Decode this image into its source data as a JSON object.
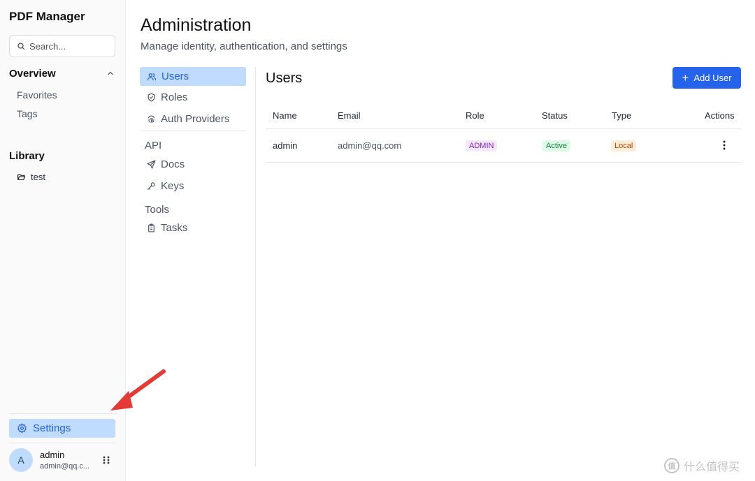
{
  "app": {
    "title": "PDF Manager"
  },
  "search": {
    "placeholder": "Search..."
  },
  "sidebar": {
    "overview": {
      "label": "Overview",
      "items": [
        {
          "label": "Favorites"
        },
        {
          "label": "Tags"
        }
      ]
    },
    "library": {
      "label": "Library",
      "items": [
        {
          "label": "test",
          "icon": "folder-open-icon"
        }
      ]
    },
    "settings_label": "Settings",
    "user": {
      "initial": "A",
      "name": "admin",
      "email": "admin@qq.c..."
    }
  },
  "page": {
    "title": "Administration",
    "subtitle": "Manage identity, authentication, and settings"
  },
  "subnav": {
    "primary": [
      {
        "label": "Users",
        "icon": "users-icon",
        "active": true
      },
      {
        "label": "Roles",
        "icon": "shield-icon"
      },
      {
        "label": "Auth Providers",
        "icon": "fingerprint-icon"
      }
    ],
    "api": {
      "label": "API",
      "items": [
        {
          "label": "Docs",
          "icon": "send-icon"
        },
        {
          "label": "Keys",
          "icon": "key-icon"
        }
      ]
    },
    "tools": {
      "label": "Tools",
      "items": [
        {
          "label": "Tasks",
          "icon": "clipboard-icon"
        }
      ]
    }
  },
  "users": {
    "title": "Users",
    "add_button": "Add User",
    "columns": {
      "name": "Name",
      "email": "Email",
      "role": "Role",
      "status": "Status",
      "type": "Type",
      "actions": "Actions"
    },
    "rows": [
      {
        "name": "admin",
        "email": "admin@qq.com",
        "role": "ADMIN",
        "status": "Active",
        "type": "Local"
      }
    ]
  },
  "watermark": {
    "mark": "值",
    "text": "什么值得买"
  },
  "colors": {
    "accent": "#2563eb",
    "active_bg": "#bfdbfe",
    "annotation_arrow": "#e53935"
  }
}
